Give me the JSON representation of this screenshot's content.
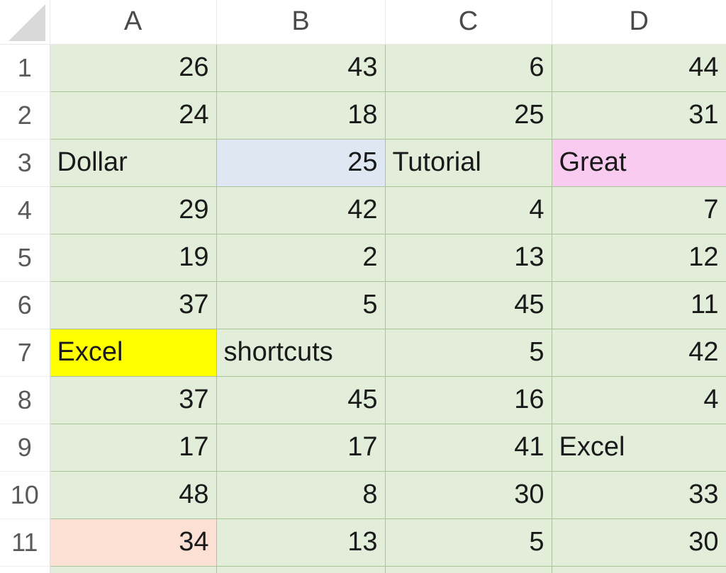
{
  "app": {
    "type": "spreadsheet",
    "select_all_corner_icon": "select-all-triangle-icon"
  },
  "grid": {
    "column_headers": [
      "A",
      "B",
      "C",
      "D"
    ],
    "row_headers": [
      "1",
      "2",
      "3",
      "4",
      "5",
      "6",
      "7",
      "8",
      "9",
      "10",
      "11"
    ],
    "default_fill": "#E2EDDA",
    "gridline_color": "#A9C49A",
    "fills": {
      "blue": "#DEE7F2",
      "pink": "#FACBF0",
      "yellow": "#FFFF00",
      "peach": "#FBE0D3",
      "green": "#E2EDDA"
    }
  },
  "rows": [
    {
      "header": "1",
      "cells": [
        {
          "value": "26",
          "align": "num",
          "fill": "green"
        },
        {
          "value": "43",
          "align": "num",
          "fill": "green"
        },
        {
          "value": "6",
          "align": "num",
          "fill": "green"
        },
        {
          "value": "44",
          "align": "num",
          "fill": "green"
        }
      ]
    },
    {
      "header": "2",
      "cells": [
        {
          "value": "24",
          "align": "num",
          "fill": "green"
        },
        {
          "value": "18",
          "align": "num",
          "fill": "green"
        },
        {
          "value": "25",
          "align": "num",
          "fill": "green"
        },
        {
          "value": "31",
          "align": "num",
          "fill": "green"
        }
      ]
    },
    {
      "header": "3",
      "cells": [
        {
          "value": "Dollar",
          "align": "text",
          "fill": "green"
        },
        {
          "value": "25",
          "align": "num",
          "fill": "blue"
        },
        {
          "value": "Tutorial",
          "align": "text",
          "fill": "green"
        },
        {
          "value": "Great",
          "align": "text",
          "fill": "pink"
        }
      ]
    },
    {
      "header": "4",
      "cells": [
        {
          "value": "29",
          "align": "num",
          "fill": "green"
        },
        {
          "value": "42",
          "align": "num",
          "fill": "green"
        },
        {
          "value": "4",
          "align": "num",
          "fill": "green"
        },
        {
          "value": "7",
          "align": "num",
          "fill": "green"
        }
      ]
    },
    {
      "header": "5",
      "cells": [
        {
          "value": "19",
          "align": "num",
          "fill": "green"
        },
        {
          "value": "2",
          "align": "num",
          "fill": "green"
        },
        {
          "value": "13",
          "align": "num",
          "fill": "green"
        },
        {
          "value": "12",
          "align": "num",
          "fill": "green"
        }
      ]
    },
    {
      "header": "6",
      "cells": [
        {
          "value": "37",
          "align": "num",
          "fill": "green"
        },
        {
          "value": "5",
          "align": "num",
          "fill": "green"
        },
        {
          "value": "45",
          "align": "num",
          "fill": "green"
        },
        {
          "value": "11",
          "align": "num",
          "fill": "green"
        }
      ]
    },
    {
      "header": "7",
      "cells": [
        {
          "value": "Excel",
          "align": "text",
          "fill": "yellow"
        },
        {
          "value": "shortcuts",
          "align": "text",
          "fill": "green"
        },
        {
          "value": "5",
          "align": "num",
          "fill": "green"
        },
        {
          "value": "42",
          "align": "num",
          "fill": "green"
        }
      ]
    },
    {
      "header": "8",
      "cells": [
        {
          "value": "37",
          "align": "num",
          "fill": "green"
        },
        {
          "value": "45",
          "align": "num",
          "fill": "green"
        },
        {
          "value": "16",
          "align": "num",
          "fill": "green"
        },
        {
          "value": "4",
          "align": "num",
          "fill": "green"
        }
      ]
    },
    {
      "header": "9",
      "cells": [
        {
          "value": "17",
          "align": "num",
          "fill": "green"
        },
        {
          "value": "17",
          "align": "num",
          "fill": "green"
        },
        {
          "value": "41",
          "align": "num",
          "fill": "green"
        },
        {
          "value": "Excel",
          "align": "text",
          "fill": "green"
        }
      ]
    },
    {
      "header": "10",
      "cells": [
        {
          "value": "48",
          "align": "num",
          "fill": "green"
        },
        {
          "value": "8",
          "align": "num",
          "fill": "green"
        },
        {
          "value": "30",
          "align": "num",
          "fill": "green"
        },
        {
          "value": "33",
          "align": "num",
          "fill": "green"
        }
      ]
    },
    {
      "header": "11",
      "cells": [
        {
          "value": "34",
          "align": "num",
          "fill": "peach"
        },
        {
          "value": "13",
          "align": "num",
          "fill": "green"
        },
        {
          "value": "5",
          "align": "num",
          "fill": "green"
        },
        {
          "value": "30",
          "align": "num",
          "fill": "green"
        }
      ]
    }
  ]
}
